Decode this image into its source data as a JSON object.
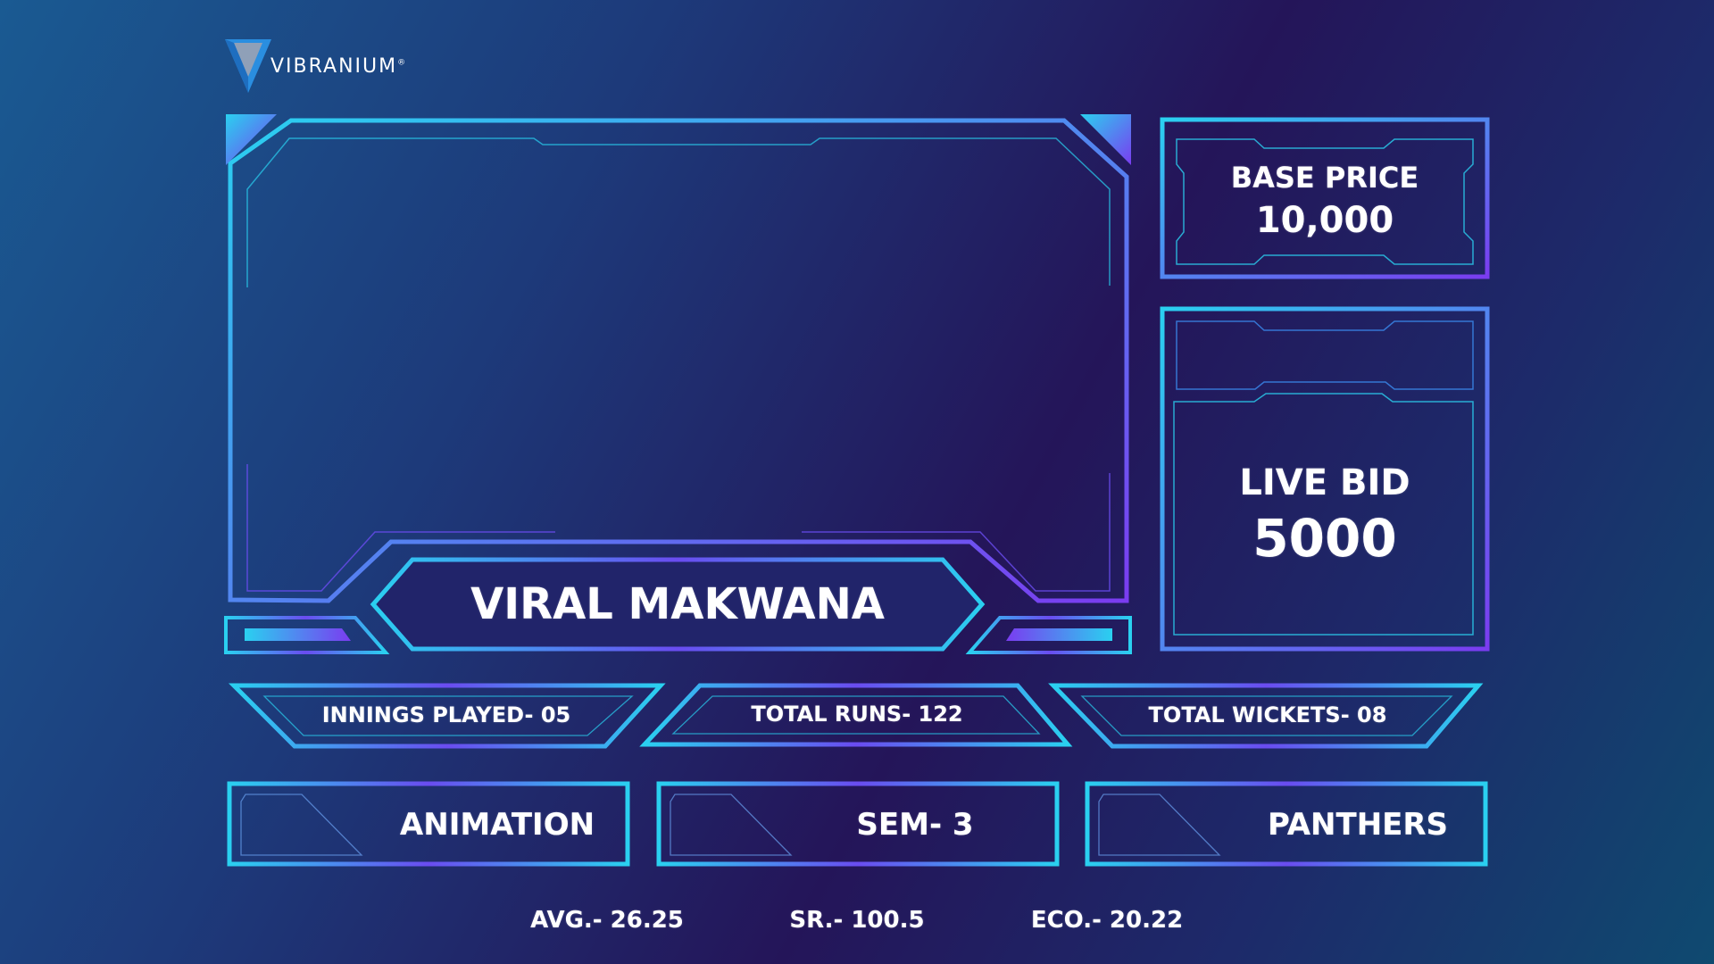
{
  "brand": {
    "name": "VIBRANIUM",
    "mark": "®"
  },
  "player": {
    "name": "VIRAL MAKWANA"
  },
  "base_price": {
    "label": "BASE PRICE",
    "value": "10,000"
  },
  "live_bid": {
    "label": "LIVE BID",
    "value": "5000"
  },
  "stats": [
    {
      "text": "INNINGS PLAYED- 05"
    },
    {
      "text": "TOTAL RUNS- 122"
    },
    {
      "text": "TOTAL WICKETS- 08"
    }
  ],
  "tags": [
    {
      "text": "ANIMATION"
    },
    {
      "text": "SEM- 3"
    },
    {
      "text": "PANTHERS"
    }
  ],
  "footer": [
    {
      "text": "AVG.- 26.25"
    },
    {
      "text": "SR.- 100.5"
    },
    {
      "text": "ECO.- 20.22"
    }
  ],
  "colors": {
    "cyan": "#2ad0f0",
    "violet": "#7a3cf0",
    "blue": "#3b7cf0"
  }
}
